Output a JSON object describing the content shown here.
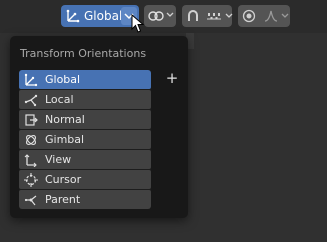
{
  "header": {
    "orientation_dropdown": {
      "label": "Global",
      "icon": "transform-orientation-icon"
    },
    "pivot_icon": "pivot-icon",
    "snap_icon": "snap-magnet-icon",
    "snap_target_icon": "snap-increment-icon",
    "proportional_icon": "proportional-editing-icon",
    "falloff_icon": "falloff-curve-icon"
  },
  "menu": {
    "title": "Transform Orientations",
    "add_symbol": "+",
    "items": [
      {
        "label": "Global",
        "icon": "global-axes-icon",
        "selected": true
      },
      {
        "label": "Local",
        "icon": "local-axes-icon",
        "selected": false
      },
      {
        "label": "Normal",
        "icon": "normal-icon",
        "selected": false
      },
      {
        "label": "Gimbal",
        "icon": "gimbal-icon",
        "selected": false
      },
      {
        "label": "View",
        "icon": "view-icon",
        "selected": false
      },
      {
        "label": "Cursor",
        "icon": "cursor-icon",
        "selected": false
      },
      {
        "label": "Parent",
        "icon": "parent-icon",
        "selected": false
      }
    ]
  },
  "colors": {
    "accent": "#4772b3",
    "menu_bg": "#181818",
    "item_bg": "#424242"
  }
}
